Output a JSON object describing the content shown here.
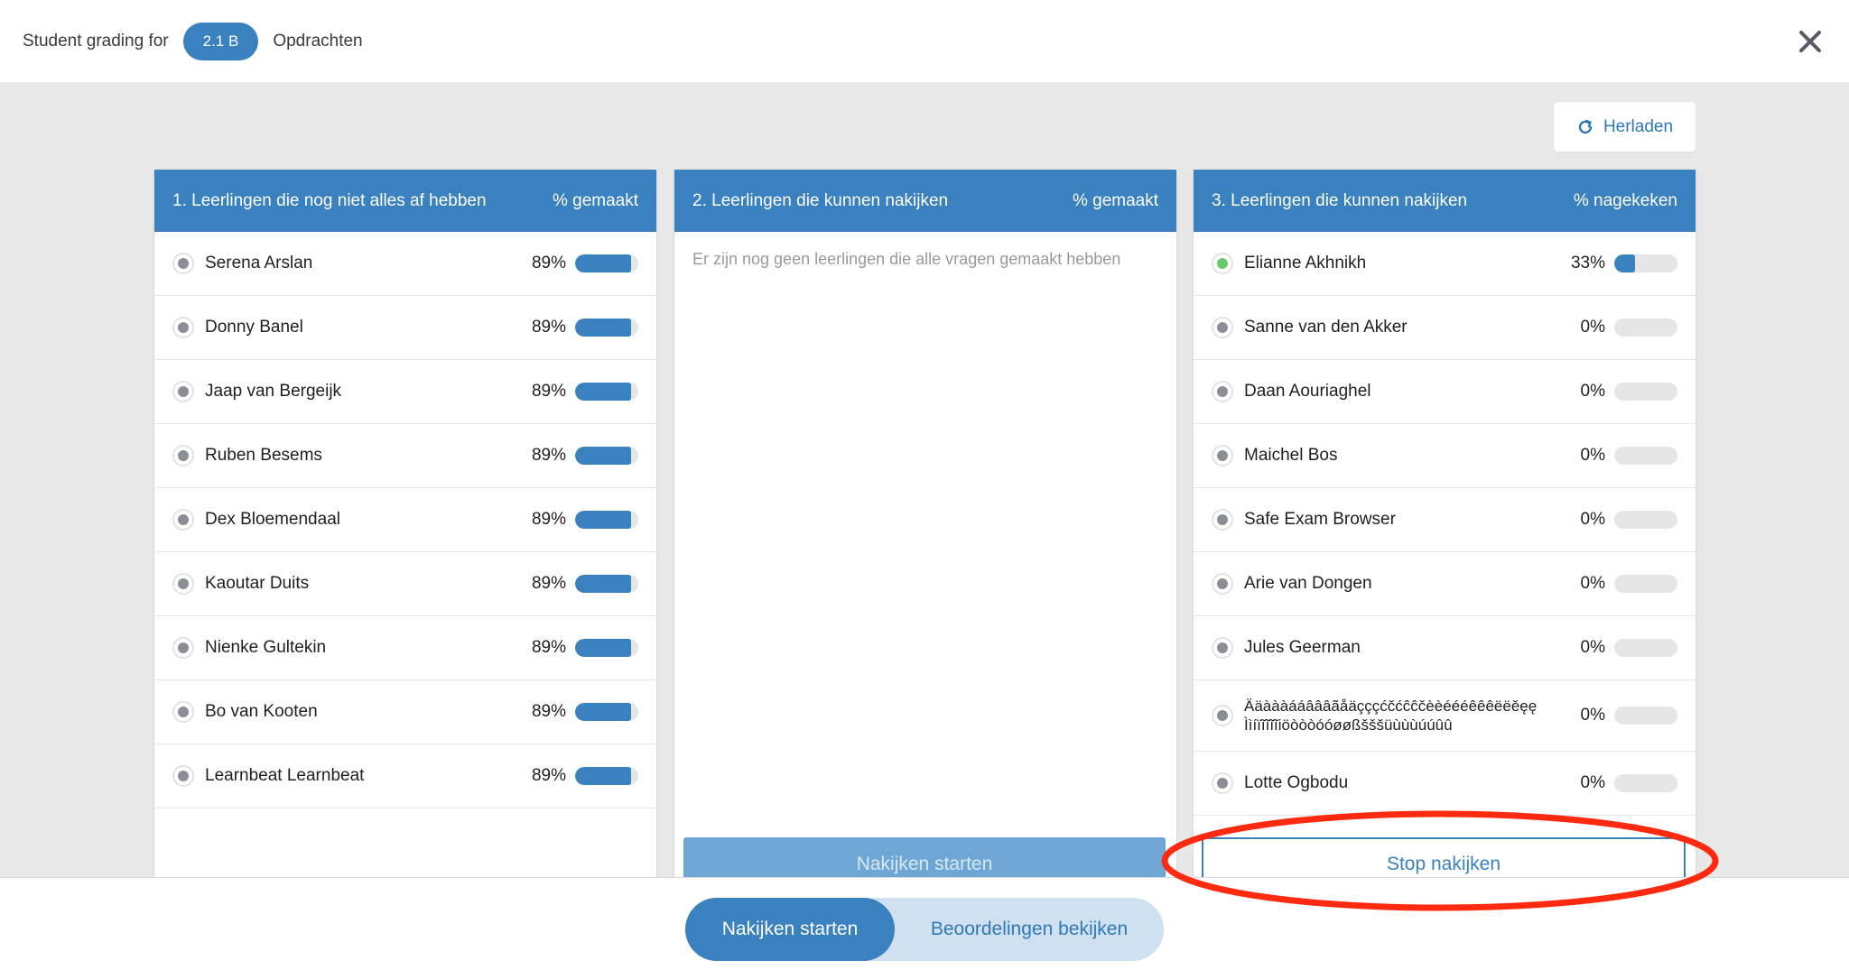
{
  "header": {
    "label": "Student grading for",
    "class_pill": "2.1 B",
    "crumb": "Opdrachten"
  },
  "reload_label": "Herladen",
  "panels": {
    "left": {
      "title": "1. Leerlingen die nog niet alles af hebben",
      "col": "% gemaakt",
      "rows": [
        {
          "name": "Serena Arslan",
          "pct": "89%",
          "value": 89
        },
        {
          "name": "Donny Banel",
          "pct": "89%",
          "value": 89
        },
        {
          "name": "Jaap van Bergeijk",
          "pct": "89%",
          "value": 89
        },
        {
          "name": "Ruben Besems",
          "pct": "89%",
          "value": 89
        },
        {
          "name": "Dex Bloemendaal",
          "pct": "89%",
          "value": 89
        },
        {
          "name": "Kaoutar Duits",
          "pct": "89%",
          "value": 89
        },
        {
          "name": "Nienke Gultekin",
          "pct": "89%",
          "value": 89
        },
        {
          "name": "Bo van Kooten",
          "pct": "89%",
          "value": 89
        },
        {
          "name": "Learnbeat Learnbeat",
          "pct": "89%",
          "value": 89
        }
      ]
    },
    "middle": {
      "title": "2. Leerlingen die kunnen nakijken",
      "col": "% gemaakt",
      "empty": "Er zijn nog geen leerlingen die alle vragen gemaakt hebben",
      "button": "Nakijken starten"
    },
    "right": {
      "title": "3. Leerlingen die kunnen nakijken",
      "col": "% nagekeken",
      "rows": [
        {
          "name": "Elianne Akhnikh",
          "pct": "33%",
          "value": 33,
          "status": "green"
        },
        {
          "name": "Sanne van den Akker",
          "pct": "0%",
          "value": 0
        },
        {
          "name": "Daan Aouriaghel",
          "pct": "0%",
          "value": 0
        },
        {
          "name": "Maichel Bos",
          "pct": "0%",
          "value": 0
        },
        {
          "name": "Safe Exam Browser",
          "pct": "0%",
          "value": 0
        },
        {
          "name": "Arie van Dongen",
          "pct": "0%",
          "value": 0
        },
        {
          "name": "Jules Geerman",
          "pct": "0%",
          "value": 0
        },
        {
          "name": "Ääàààááâââãåäçççćčćĉĉčèèéééêêêëëěęę Ììíïĩĩĩĩiöòòòóóøøßšššüùùùúúûû",
          "pct": "0%",
          "value": 0,
          "tall": true
        },
        {
          "name": "Lotte Ogbodu",
          "pct": "0%",
          "value": 0
        }
      ],
      "button": "Stop nakijken"
    }
  },
  "toggle": {
    "active": "Nakijken starten",
    "inactive": "Beoordelingen bekijken"
  },
  "colors": {
    "primary": "#3a81bf",
    "annotation": "#ff2a10",
    "online": "#69c96b"
  }
}
